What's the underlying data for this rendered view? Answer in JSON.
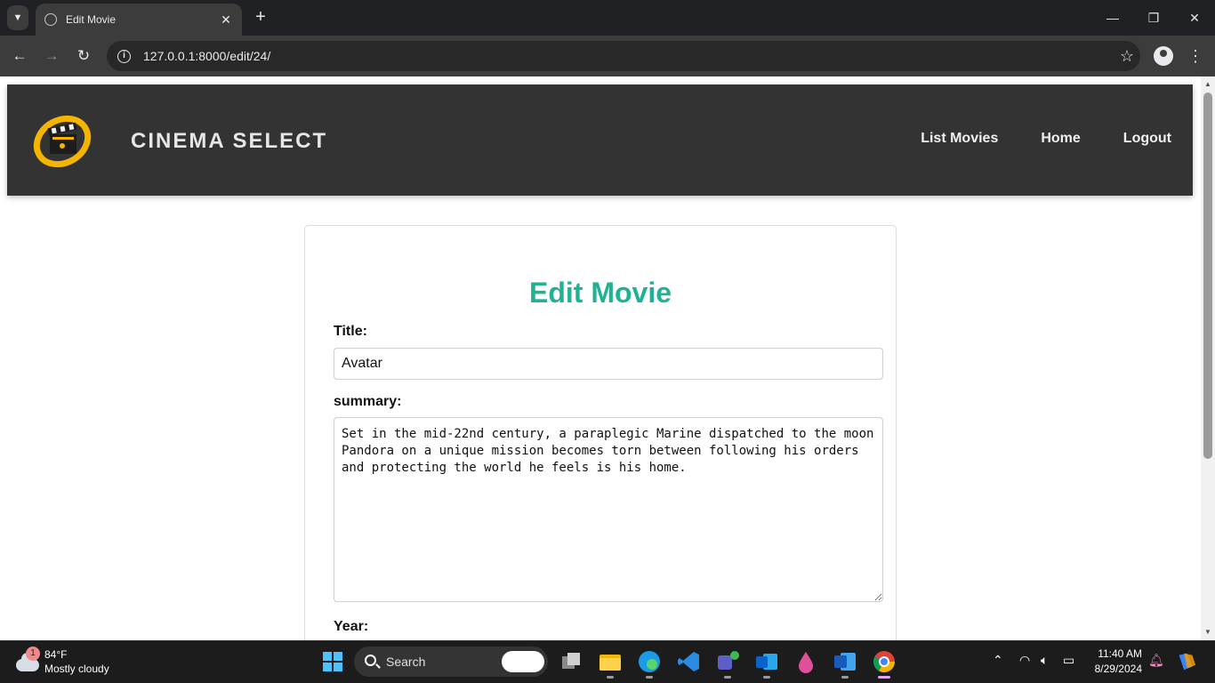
{
  "browser": {
    "tab_title": "Edit Movie",
    "tab_close": "✕",
    "new_tab": "+",
    "url": "127.0.0.1:8000/edit/24/",
    "minimize": "—",
    "restore": "❐",
    "close": "✕"
  },
  "site": {
    "brand": "CINEMA SELECT",
    "nav": [
      "List Movies",
      "Home",
      "Logout"
    ]
  },
  "form": {
    "heading": "Edit Movie",
    "title_label": "Title:",
    "title_value": "Avatar",
    "summary_label": "summary:",
    "summary_value": "Set in the mid-22nd century, a paraplegic Marine dispatched to the moon Pandora on a unique mission becomes torn between following his orders and protecting the world he feels is his home.",
    "year_label": "Year:"
  },
  "taskbar": {
    "weather_badge": "1",
    "temperature": "84°F",
    "condition": "Mostly cloudy",
    "search_label": "Search",
    "time": "11:40 AM",
    "date": "8/29/2024"
  },
  "colors": {
    "heading": "#20b293",
    "header_bg": "#333333",
    "logo": "#f5b400"
  }
}
